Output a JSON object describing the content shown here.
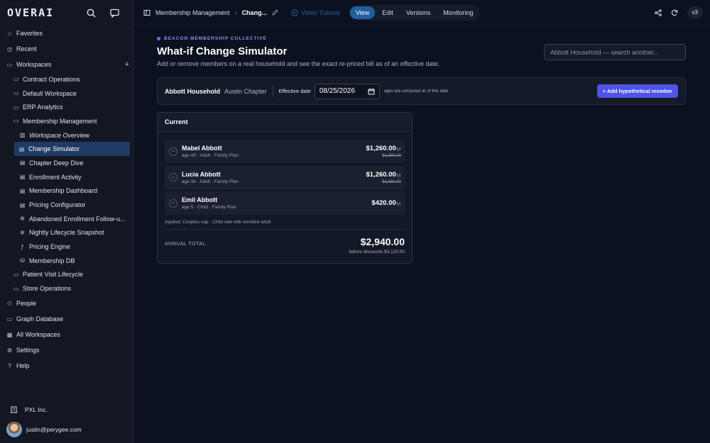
{
  "app": {
    "logo": "OVERAI"
  },
  "sidebar": {
    "top": [
      {
        "label": "Favorites",
        "icon": "star-icon"
      },
      {
        "label": "Recent",
        "icon": "clock-icon"
      },
      {
        "label": "Workspaces",
        "icon": "folder-icon"
      }
    ],
    "workspaces": [
      "Contract Operations",
      "Default Workspace",
      "ERP Analytics",
      "Membership Management"
    ],
    "membership_children": [
      {
        "label": "Workspace Overview",
        "icon": "book-icon"
      },
      {
        "label": "Change Simulator",
        "icon": "doc-icon"
      },
      {
        "label": "Chapter Deep Dive",
        "icon": "doc-icon"
      },
      {
        "label": "Enrollment Activity",
        "icon": "doc-icon"
      },
      {
        "label": "Membership Dashboard",
        "icon": "doc-icon"
      },
      {
        "label": "Pricing Configurator",
        "icon": "doc-icon"
      },
      {
        "label": "Abandoned Enrollment Follow-u...",
        "icon": "workflow-icon"
      },
      {
        "label": "Nightly Lifecycle Snapshot",
        "icon": "workflow-icon"
      },
      {
        "label": "Pricing Engine",
        "icon": "function-icon"
      },
      {
        "label": "Membership DB",
        "icon": "database-icon"
      }
    ],
    "more_workspaces": [
      "Patient Visit Lifecycle",
      "Store Operations"
    ],
    "bottom": [
      {
        "label": "People",
        "icon": "people-icon"
      },
      {
        "label": "Graph Database",
        "icon": "graph-icon"
      },
      {
        "label": "All Workspaces",
        "icon": "grid-icon"
      },
      {
        "label": "Settings",
        "icon": "gear-icon"
      },
      {
        "label": "Help",
        "icon": "help-icon"
      }
    ],
    "org": "PXL Inc.",
    "user_email": "justin@perygee.com"
  },
  "topbar": {
    "breadcrumb_parent": "Membership Management",
    "breadcrumb_current": "Chang...",
    "video_tutorial": "Video Tutorial",
    "modes": [
      "View",
      "Edit",
      "Versions",
      "Monitoring"
    ],
    "active_mode": "View",
    "version": "v3"
  },
  "page": {
    "eyebrow": "BEACON MEMBERSHIP COLLECTIVE",
    "title": "What-if Change Simulator",
    "subtitle": "Add or remove members on a real household and see the exact re-priced bill as of an effective date.",
    "search_placeholder": "Abbott Household — search another..."
  },
  "household": {
    "name": "Abbott Household",
    "chapter": "Austin Chapter",
    "effective_label": "Effective date",
    "effective_date": "08/25/2026",
    "ages_note": "ages are computed as of this date",
    "add_button": "+ Add hypothetical member"
  },
  "current": {
    "heading": "Current",
    "members": [
      {
        "name": "Mabel Abbott",
        "meta": "age 43 · Adult · Family Plan",
        "price": "$1,260.00",
        "per": "/yr",
        "old": "$1,350.00"
      },
      {
        "name": "Lucia Abbott",
        "meta": "age 34 · Adult · Family Plan",
        "price": "$1,260.00",
        "per": "/yr",
        "old": "$1,350.00"
      },
      {
        "name": "Emil Abbott",
        "meta": "age 5 · Child · Family Plan",
        "price": "$420.00",
        "per": "/yr",
        "old": ""
      }
    ],
    "applied": "Applied: Couples cap · Child rate with enrolled adult",
    "total_label": "ANNUAL TOTAL",
    "total": "$2,940.00",
    "before_discounts": "before discounts $3,120.00"
  },
  "colors": {
    "accent": "#4f53e6",
    "active_nav": "#1f3a64",
    "active_mode": "#1e5fa0",
    "background": "#0c1120"
  }
}
